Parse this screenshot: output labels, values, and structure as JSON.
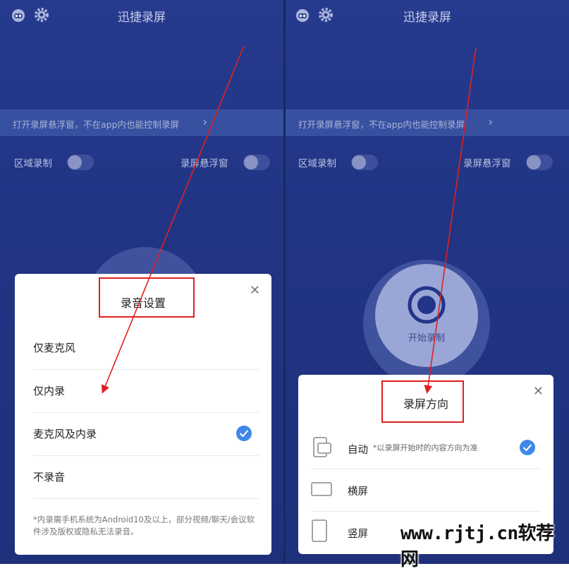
{
  "app": {
    "title": "迅捷录屏",
    "banner_text": "打开录屏悬浮窗，不在app内也能控制录屏",
    "region_record_label": "区域录制",
    "floating_window_label": "录屏悬浮窗",
    "start_record_label": "开始录制",
    "icons": {
      "left": "robot-icon",
      "right": "gear-icon",
      "chevron": "chevron-right-icon"
    }
  },
  "audio_sheet": {
    "title": "录音设置",
    "options": [
      {
        "label": "仅麦克风",
        "selected": false
      },
      {
        "label": "仅内录",
        "selected": false
      },
      {
        "label": "麦克风及内录",
        "selected": true
      },
      {
        "label": "不录音",
        "selected": false
      }
    ],
    "note": "*内录需手机系统为Android10及以上，部分视频/聊天/会议软件涉及版权或隐私无法录音。"
  },
  "orientation_sheet": {
    "title": "录屏方向",
    "options": [
      {
        "label": "自动",
        "sub": "*以录屏开始时的内容方向为准",
        "selected": true,
        "icon": "auto-rotate-icon"
      },
      {
        "label": "横屏",
        "sub": "",
        "selected": false,
        "icon": "landscape-icon"
      },
      {
        "label": "竖屏",
        "sub": "",
        "selected": false,
        "icon": "portrait-icon"
      }
    ]
  },
  "watermark": "www.rjtj.cn软荐网",
  "colors": {
    "accent": "#3f87e8",
    "annotation_red": "#e02020",
    "background": "#223585"
  }
}
